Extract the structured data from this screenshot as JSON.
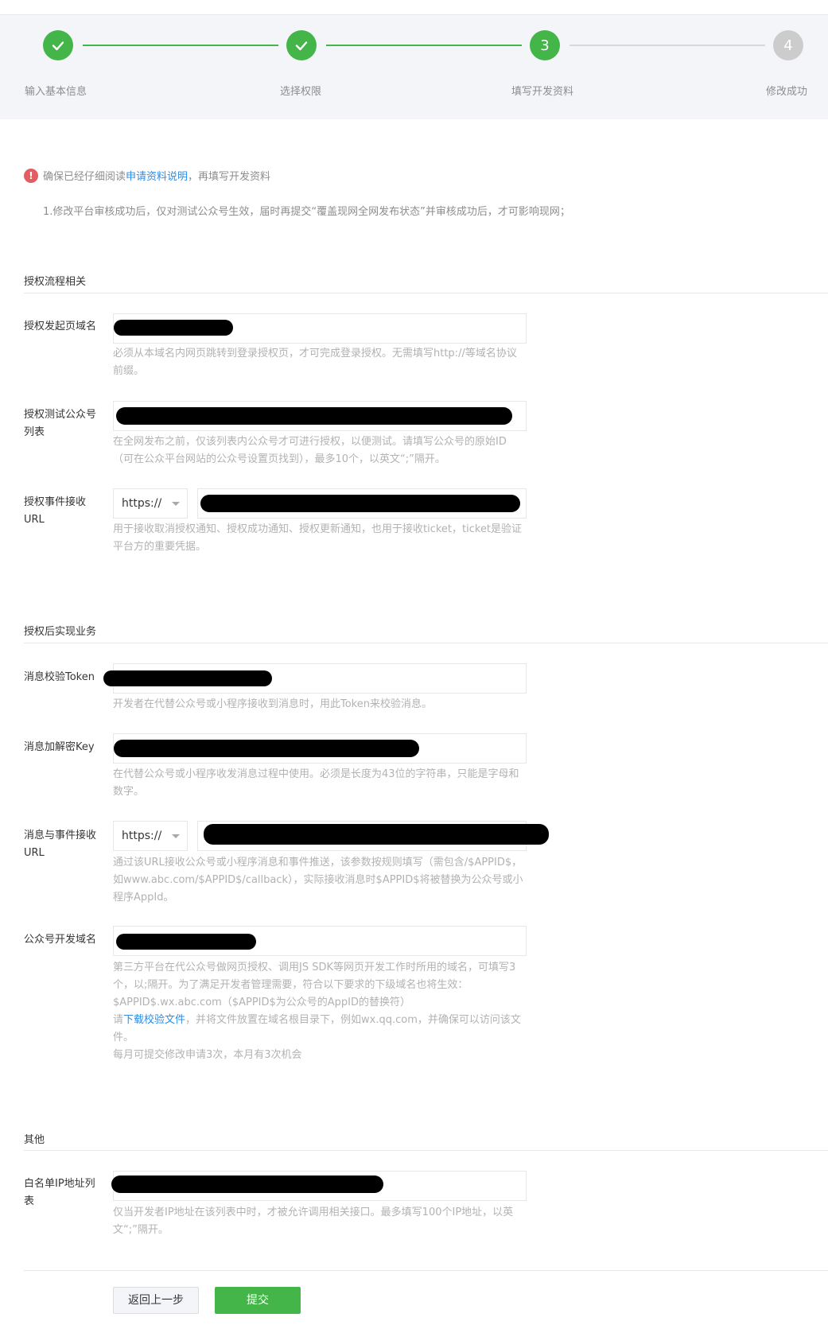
{
  "steps": [
    {
      "label": "输入基本信息",
      "status": "done"
    },
    {
      "label": "选择权限",
      "status": "done"
    },
    {
      "label": "填写开发资料",
      "status": "current",
      "number": "3"
    },
    {
      "label": "修改成功",
      "status": "pending",
      "number": "4"
    }
  ],
  "notice": {
    "prefix": "确保已经仔细阅读",
    "link": "申请资料说明",
    "suffix": "，再填写开发资料",
    "line1": "1.修改平台审核成功后，仅对测试公众号生效，届时再提交“覆盖现网全网发布状态”并审核成功后，才可影响现网；"
  },
  "sections": {
    "auth_flow": "授权流程相关",
    "post_auth": "授权后实现业务",
    "other": "其他"
  },
  "fields": {
    "auth_domain": {
      "label": "授权发起页域名",
      "value": "",
      "hint": "必须从本域名内网页跳转到登录授权页，才可完成登录授权。无需填写http://等域名协议前缀。"
    },
    "test_accounts": {
      "label": "授权测试公众号列表",
      "value": "",
      "hint": "在全网发布之前，仅该列表内公众号才可进行授权，以便测试。请填写公众号的原始ID（可在公众平台网站的公众号设置页找到），最多10个，以英文“;”隔开。"
    },
    "auth_event_url": {
      "label": "授权事件接收URL",
      "protocol": "https://",
      "value": "",
      "hint": "用于接收取消授权通知、授权成功通知、授权更新通知，也用于接收ticket，ticket是验证平台方的重要凭据。"
    },
    "msg_token": {
      "label": "消息校验Token",
      "value": "",
      "hint": "开发者在代替公众号或小程序接收到消息时，用此Token来校验消息。"
    },
    "msg_key": {
      "label": "消息加解密Key",
      "value": "",
      "hint": "在代替公众号或小程序收发消息过程中使用。必须是长度为43位的字符串，只能是字母和数字。"
    },
    "msg_event_url": {
      "label": "消息与事件接收URL",
      "protocol": "https://",
      "value": "",
      "hint": "通过该URL接收公众号或小程序消息和事件推送，该参数按规则填写（需包含/$APPID$，如www.abc.com/$APPID$/callback），实际接收消息时$APPID$将被替换为公众号或小程序AppId。"
    },
    "dev_domain": {
      "label": "公众号开发域名",
      "value": "",
      "hint1": "第三方平台在代公众号做网页授权、调用JS SDK等网页开发工作时所用的域名，可填写3个，以;隔开。为了满足开发者管理需要，符合以下要求的下级域名也将生效：$APPID$.wx.abc.com（$APPID$为公众号的AppID的替换符）",
      "hint2_prefix": "请",
      "hint2_link": "下载校验文件",
      "hint2_suffix": "，并将文件放置在域名根目录下，例如wx.qq.com，并确保可以访问该文件。",
      "hint3": "每月可提交修改申请3次，本月有3次机会"
    },
    "ip_whitelist": {
      "label": "白名单IP地址列表",
      "value": "",
      "hint": "仅当开发者IP地址在该列表中时，才被允许调用相关接口。最多填写100个IP地址，以英文“;”隔开。"
    }
  },
  "buttons": {
    "back": "返回上一步",
    "submit": "提交"
  },
  "colors": {
    "accent": "#44b549",
    "link": "#2e8ce4",
    "warning": "#e15f63"
  }
}
